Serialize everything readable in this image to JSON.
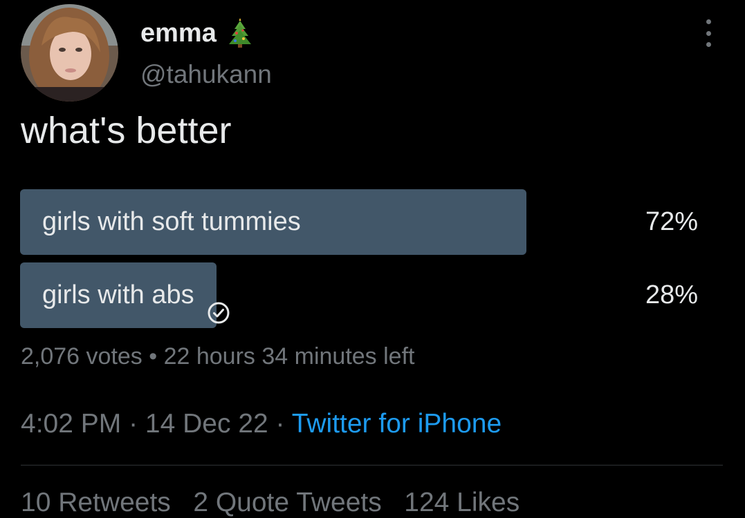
{
  "author": {
    "display_name": "emma",
    "name_emoji": "christmas-tree-emoji",
    "handle": "@tahukann",
    "avatar": "profile-photo"
  },
  "tweet": {
    "text": "what's better"
  },
  "poll": {
    "options": [
      {
        "label": "girls with soft tummies",
        "percent_text": "72%",
        "fill_fraction": 0.732,
        "selected": false
      },
      {
        "label": "girls with abs",
        "percent_text": "28%",
        "fill_fraction": 0.284,
        "selected": true
      }
    ],
    "votes": "2,076 votes",
    "separator": " • ",
    "time_left": "22 hours 34 minutes left"
  },
  "meta": {
    "time": "4:02 PM",
    "separator": " · ",
    "date": "14 Dec 22",
    "source": "Twitter for iPhone"
  },
  "stats": {
    "retweets": "10 Retweets",
    "quotes": "2 Quote Tweets",
    "likes": "124 Likes"
  },
  "colors": {
    "background": "#000000",
    "text_primary": "#e7e9ea",
    "text_secondary": "#71767b",
    "accent": "#1d9bf0",
    "poll_bar": "#425769",
    "divider": "#2f3336"
  },
  "icons": {
    "more": "more-options-icon",
    "check": "check-circle-icon"
  }
}
